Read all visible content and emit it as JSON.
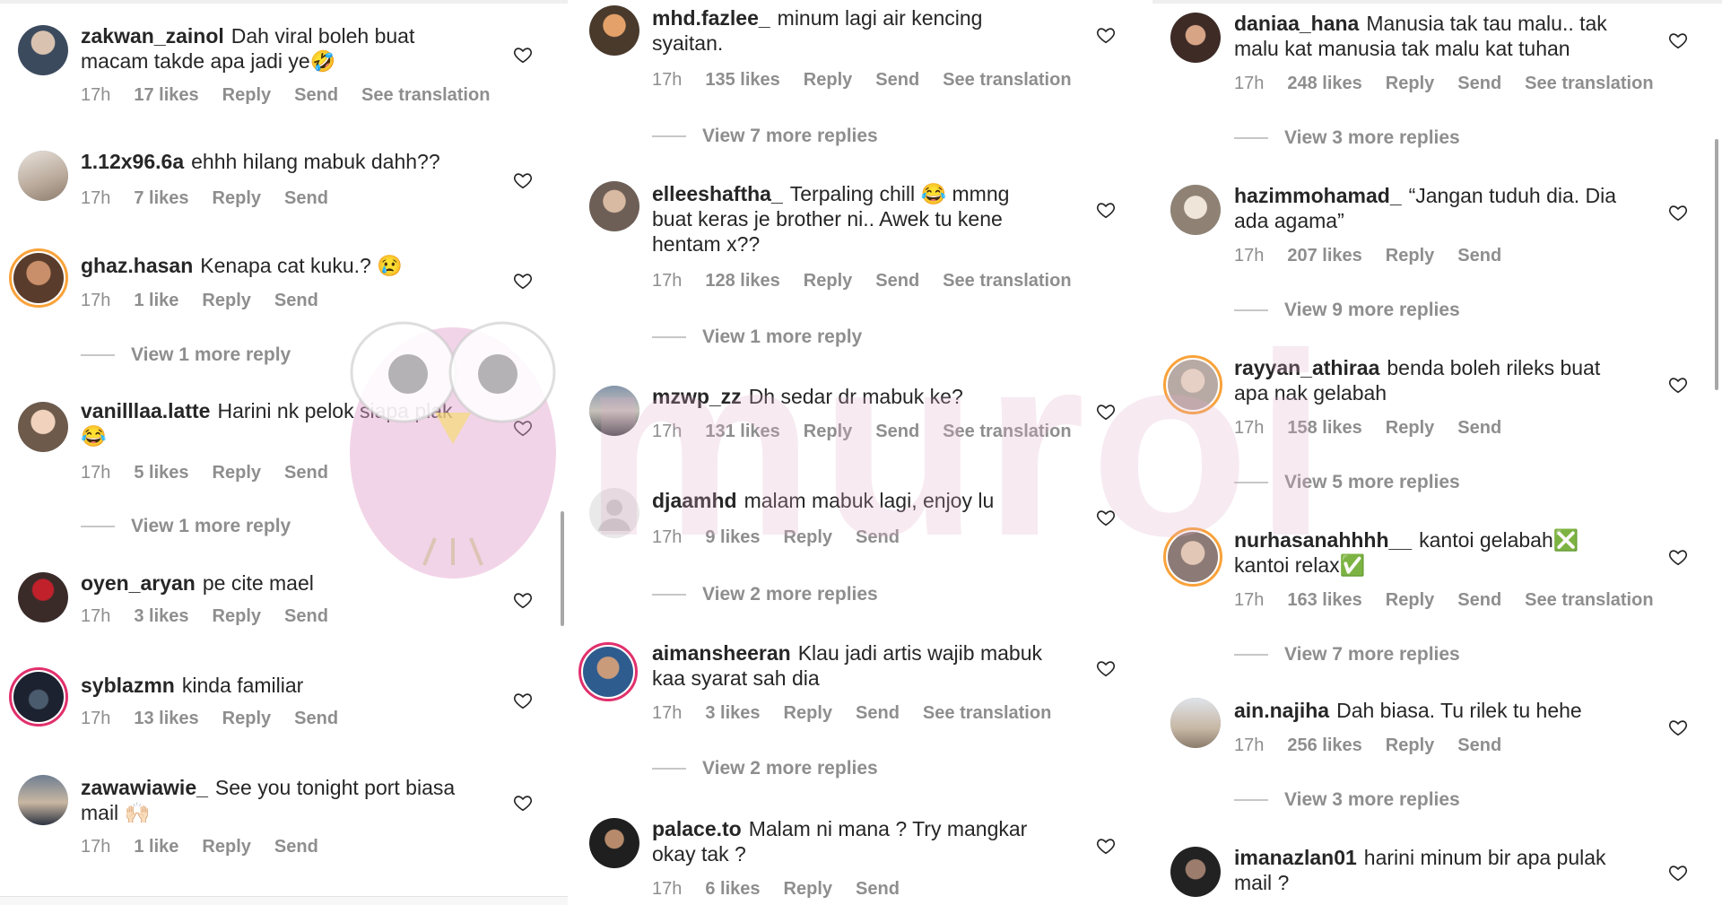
{
  "colors": {
    "username": "#262626",
    "meta": "#8e8e8e",
    "story_ring": "#e1306c",
    "watermark": "#e8b7cf"
  },
  "watermark": {
    "text": "muroi"
  },
  "columns": [
    {
      "comments": [
        {
          "username": "zakwan_zainol",
          "text": "Dah viral boleh buat macam takde apa jadi ye🤣",
          "time": "17h",
          "likes": "17 likes",
          "reply": "Reply",
          "send": "Send",
          "translate": "See translation"
        },
        {
          "username": "1.12x96.6a",
          "text": "ehhh hilang mabuk dahh??",
          "time": "17h",
          "likes": "7 likes",
          "reply": "Reply",
          "send": "Send"
        },
        {
          "username": "ghaz.hasan",
          "text": "Kenapa cat kuku.? 😢",
          "time": "17h",
          "likes": "1 like",
          "reply": "Reply",
          "send": "Send",
          "view_more": "View 1 more reply"
        },
        {
          "username": "vanilllaa.latte",
          "text": "Harini nk pelok siapa plak 😂",
          "time": "17h",
          "likes": "5 likes",
          "reply": "Reply",
          "send": "Send",
          "view_more": "View 1 more reply"
        },
        {
          "username": "oyen_aryan",
          "text": "pe cite mael",
          "time": "17h",
          "likes": "3 likes",
          "reply": "Reply",
          "send": "Send"
        },
        {
          "username": "syblazmn",
          "text": "kinda familiar",
          "time": "17h",
          "likes": "13 likes",
          "reply": "Reply",
          "send": "Send"
        },
        {
          "username": "zawawiawie_",
          "text": "See you tonight port biasa mail 🙌🏻",
          "time": "17h",
          "likes": "1 like",
          "reply": "Reply",
          "send": "Send"
        }
      ]
    },
    {
      "comments": [
        {
          "username": "mhd.fazlee_",
          "text": "minum lagi air kencing syaitan.",
          "time": "17h",
          "likes": "135 likes",
          "reply": "Reply",
          "send": "Send",
          "translate": "See translation",
          "view_more": "View 7 more replies"
        },
        {
          "username": "elleeshaftha_",
          "text": "Terpaling chill 😂 mmng buat keras je brother ni.. Awek tu kene hentam x??",
          "time": "17h",
          "likes": "128 likes",
          "reply": "Reply",
          "send": "Send",
          "translate": "See translation",
          "view_more": "View 1 more reply"
        },
        {
          "username": "mzwp_zz",
          "text": "Dh sedar dr mabuk ke?",
          "time": "17h",
          "likes": "131 likes",
          "reply": "Reply",
          "send": "Send",
          "translate": "See translation"
        },
        {
          "username": "djaamhd",
          "text": "malam mabuk lagi, enjoy lu",
          "time": "17h",
          "likes": "9 likes",
          "reply": "Reply",
          "send": "Send",
          "view_more": "View 2 more replies"
        },
        {
          "username": "aimansheeran",
          "text": "Klau jadi artis wajib mabuk kaa syarat sah dia",
          "time": "17h",
          "likes": "3 likes",
          "reply": "Reply",
          "send": "Send",
          "translate": "See translation",
          "view_more": "View 2 more replies"
        },
        {
          "username": "palace.to",
          "text": "Malam ni mana ? Try mangkar okay tak ?",
          "time": "17h",
          "likes": "6 likes",
          "reply": "Reply",
          "send": "Send"
        }
      ]
    },
    {
      "comments": [
        {
          "username": "daniaa_hana",
          "text": "Manusia tak tau malu.. tak malu kat manusia tak malu kat tuhan",
          "time": "17h",
          "likes": "248 likes",
          "reply": "Reply",
          "send": "Send",
          "translate": "See translation",
          "view_more": "View 3 more replies"
        },
        {
          "username": "hazimmohamad_",
          "text": "“Jangan tuduh dia. Dia ada agama”",
          "time": "17h",
          "likes": "207 likes",
          "reply": "Reply",
          "send": "Send",
          "view_more": "View 9 more replies"
        },
        {
          "username": "rayyan_athiraa",
          "text": "benda boleh rileks buat apa nak gelabah",
          "time": "17h",
          "likes": "158 likes",
          "reply": "Reply",
          "send": "Send",
          "view_more": "View 5 more replies"
        },
        {
          "username": "nurhasanahhhh__",
          "text": "kantoi gelabah❎ kantoi relax✅",
          "time": "17h",
          "likes": "163 likes",
          "reply": "Reply",
          "send": "Send",
          "translate": "See translation",
          "view_more": "View 7 more replies"
        },
        {
          "username": "ain.najiha",
          "text": "Dah biasa. Tu rilek tu hehe",
          "time": "17h",
          "likes": "256 likes",
          "reply": "Reply",
          "send": "Send",
          "view_more": "View 3 more replies"
        },
        {
          "username": "imanazlan01",
          "text": "harini minum bir apa pulak mail ?",
          "time": "",
          "likes": "",
          "reply": "",
          "send": ""
        }
      ]
    }
  ]
}
